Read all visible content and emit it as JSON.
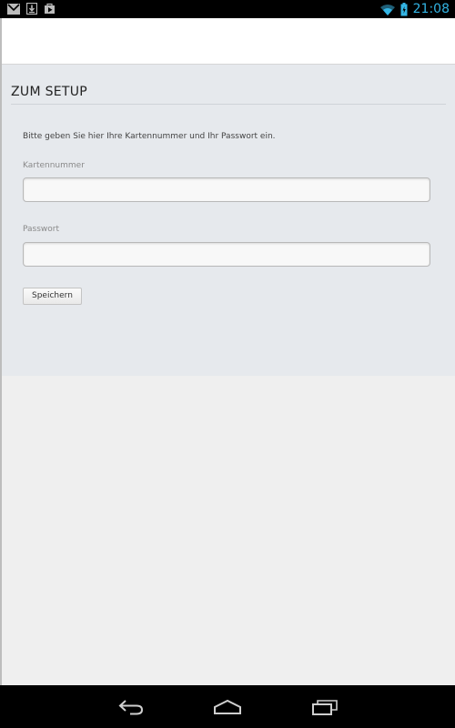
{
  "status_bar": {
    "time": "21:08",
    "left_icons": [
      "gmail-icon",
      "download-icon",
      "play-store-icon"
    ],
    "right_icons": [
      "wifi-icon",
      "battery-icon"
    ],
    "accent_color": "#33b5e5"
  },
  "page": {
    "title": "ZUM SETUP",
    "instruction": "Bitte geben Sie hier Ihre Kartennummer und Ihr Passwort ein.",
    "card_number": {
      "label": "Kartennummer",
      "value": ""
    },
    "password": {
      "label": "Passwort",
      "value": ""
    },
    "save_label": "Speichern"
  },
  "nav_bar": {
    "buttons": [
      "back-icon",
      "home-icon",
      "recent-apps-icon"
    ]
  }
}
